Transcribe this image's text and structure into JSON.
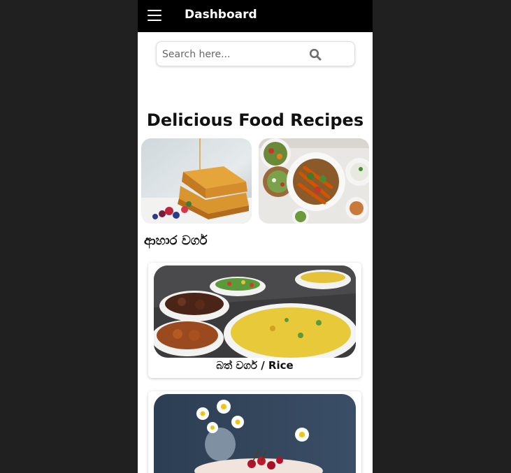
{
  "appbar": {
    "title": "Dashboard",
    "menu_icon": "hamburger-menu-icon",
    "background": "#000000"
  },
  "search": {
    "placeholder": "Search here...",
    "icon": "search-icon"
  },
  "main": {
    "heading": "Delicious Food Recipes",
    "carousel": [
      {
        "image": "waffles-with-syrup-photo"
      },
      {
        "image": "salad-platter-photo"
      }
    ],
    "section_title": "ආහාර වර්ග",
    "categories": [
      {
        "label": "බත් වර්ග / Rice",
        "image": "rice-dishes-photo"
      },
      {
        "label": "",
        "image": "cake-with-cherries-and-daisies-photo"
      }
    ]
  }
}
